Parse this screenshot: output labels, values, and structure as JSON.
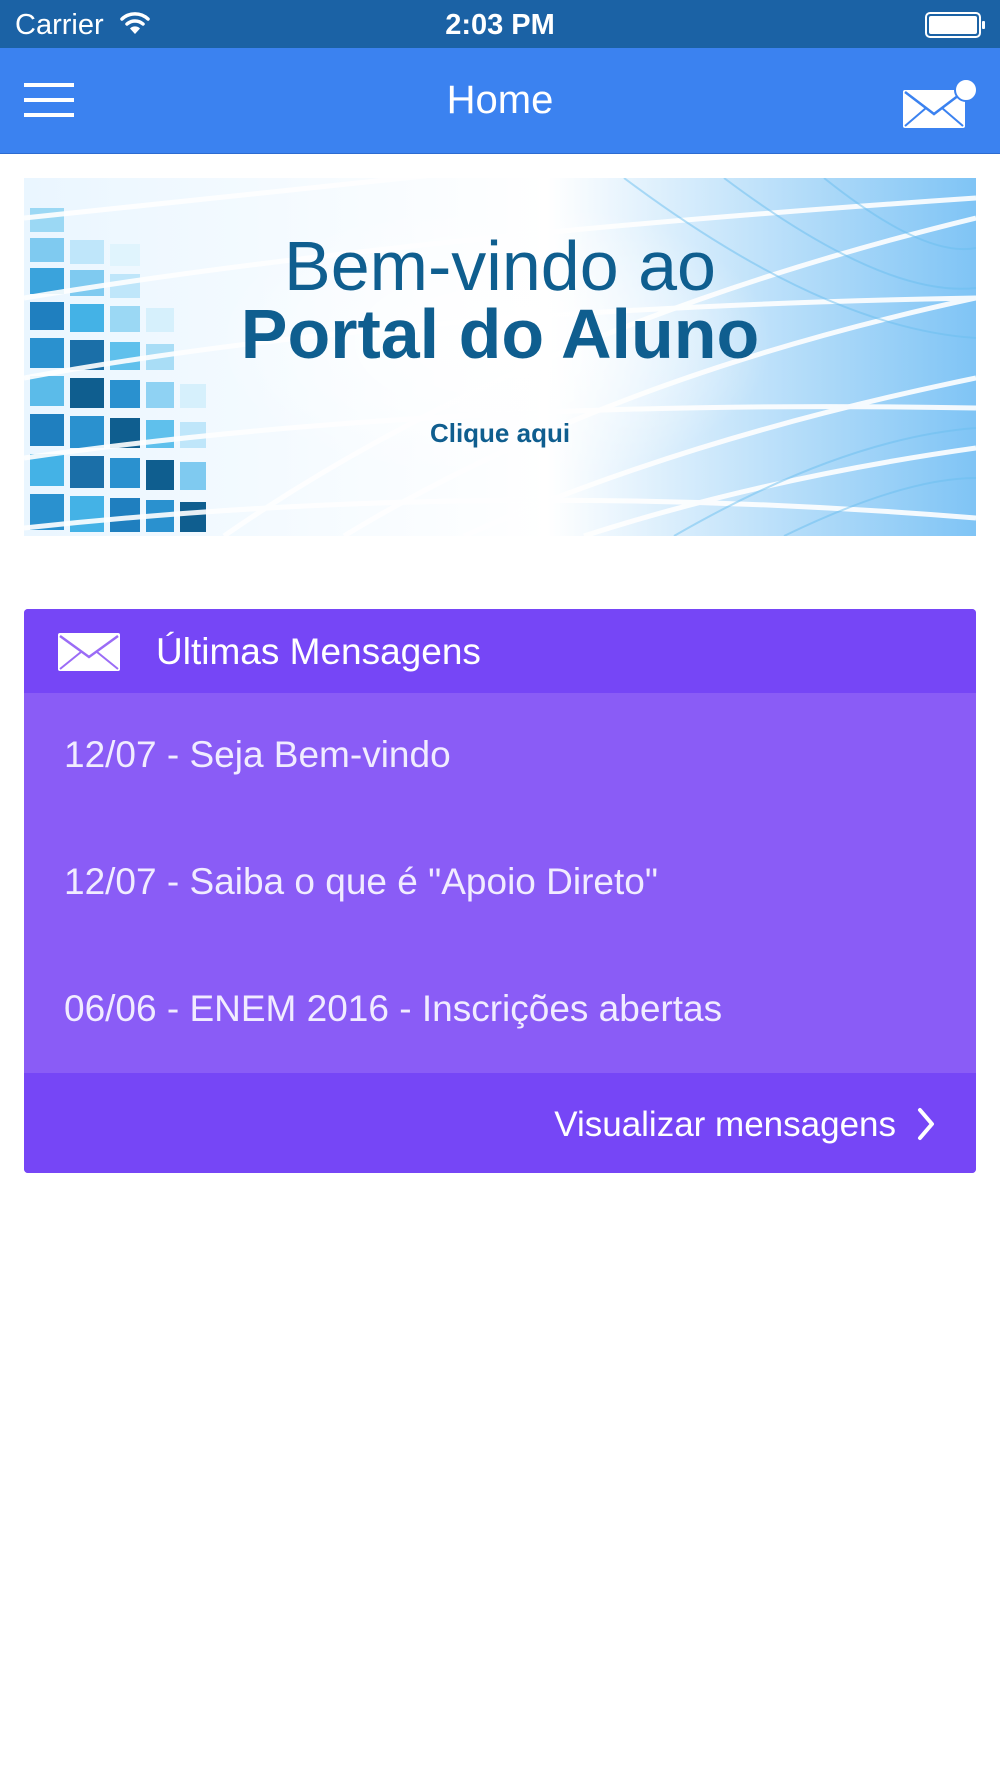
{
  "status_bar": {
    "carrier": "Carrier",
    "time": "2:03 PM",
    "wifi_icon": "wifi-icon",
    "battery_icon": "battery-icon"
  },
  "nav_bar": {
    "title": "Home",
    "menu_icon": "hamburger-menu-icon",
    "mail_icon": "mail-icon",
    "colors": {
      "background": "#3b82f0",
      "status_background": "#1b62a5"
    }
  },
  "banner": {
    "line1": "Bem-vindo ao",
    "line2": "Portal do Aluno",
    "cta": "Clique aqui"
  },
  "messages_card": {
    "title": "Últimas Mensagens",
    "header_icon": "envelope-icon",
    "items": [
      {
        "text": "12/07 - Seja Bem-vindo"
      },
      {
        "text": "12/07 - Saiba o que é \"Apoio Direto\""
      },
      {
        "text": "06/06 - ENEM 2016 - Inscrições abertas"
      }
    ],
    "footer_label": "Visualizar mensagens",
    "footer_icon": "chevron-right-icon",
    "colors": {
      "header": "#7646f6",
      "row": "#8a5cf6"
    }
  }
}
